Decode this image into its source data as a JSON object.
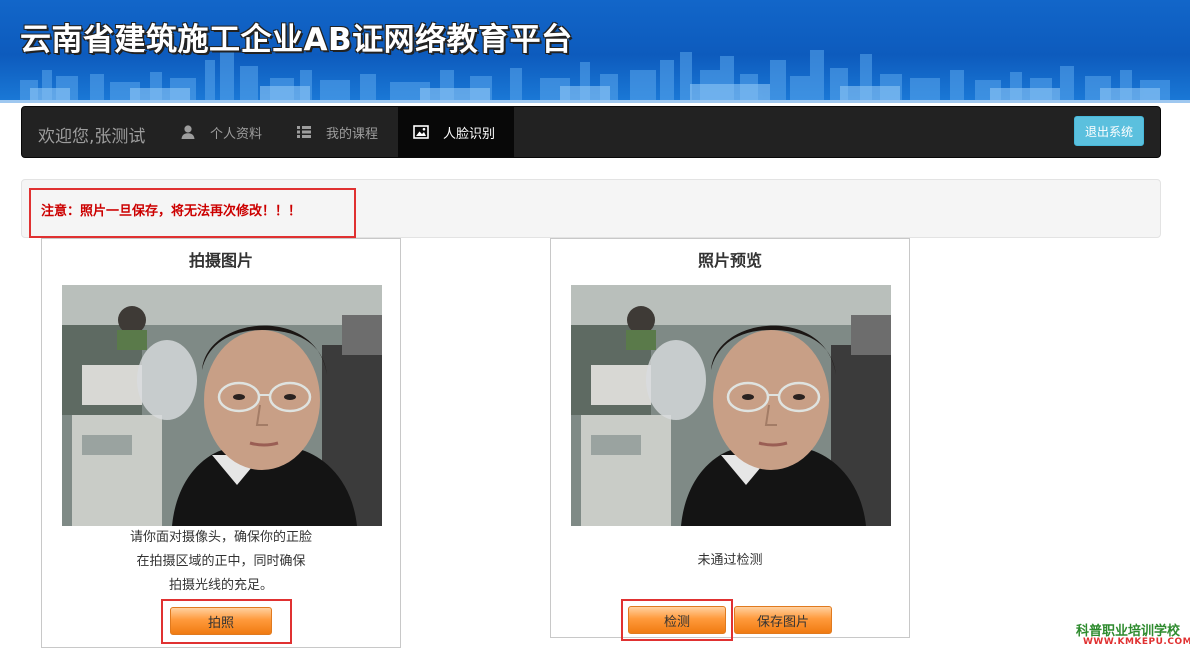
{
  "banner": {
    "title": "云南省建筑施工企业AB证网络教育平台"
  },
  "navbar": {
    "welcome": "欢迎您,张测试",
    "items": [
      {
        "label": "个人资料",
        "icon": "user-icon"
      },
      {
        "label": "我的课程",
        "icon": "list-icon"
      },
      {
        "label": "人脸识别",
        "icon": "picture-icon",
        "active": true
      }
    ],
    "logout_label": "退出系统"
  },
  "notice": {
    "text": "注意：照片一旦保存，将无法再次修改！！！"
  },
  "capture_panel": {
    "title": "拍摄图片",
    "instructions": [
      "请你面对摄像头，确保你的正脸",
      "在拍摄区域的正中，同时确保",
      "拍摄光线的充足。"
    ],
    "capture_button": "拍照"
  },
  "preview_panel": {
    "title": "照片预览",
    "status": "未通过检测",
    "detect_button": "检测",
    "save_button": "保存图片"
  },
  "watermark": {
    "name": "科普职业培训学校",
    "url": "WWW.KMKEPU.COM"
  },
  "colors": {
    "banner": "#0d5bbd",
    "navbar": "#222222",
    "notice_text": "#cc0000",
    "logout": "#5bc0de",
    "button": "#ff9a3c",
    "highlight": "#e03131"
  }
}
